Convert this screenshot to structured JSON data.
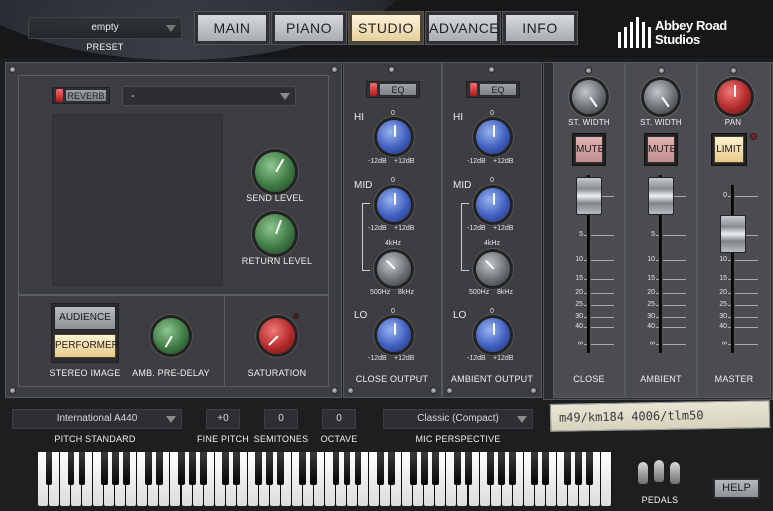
{
  "header": {
    "preset_value": "empty",
    "preset_label": "PRESET",
    "tabs": [
      "MAIN",
      "PIANO",
      "STUDIO",
      "ADVANCED",
      "INFO"
    ],
    "active_tab": "STUDIO",
    "logo_line1": "Abbey Road",
    "logo_line2": "Studios"
  },
  "reverb": {
    "toggle_label": "REVERB",
    "type_value": "-",
    "send_level_label": "SEND LEVEL",
    "return_level_label": "RETURN LEVEL"
  },
  "stereo": {
    "audience_label": "AUDIENCE",
    "performer_label": "PERFORMER",
    "stereo_image_label": "STEREO IMAGE",
    "pre_delay_label": "AMB. PRE-DELAY",
    "saturation_label": "SATURATION"
  },
  "eq": {
    "button_label": "EQ",
    "hi": "HI",
    "mid": "MID",
    "lo": "LO",
    "zero": "0",
    "minus": "-12dB",
    "plus": "+12dB",
    "freq_top": "4kHz",
    "freq_left": "500Hz",
    "freq_right": "8kHz",
    "close_output_label": "CLOSE OUTPUT",
    "ambient_output_label": "AMBIENT OUTPUT"
  },
  "mixer": {
    "st_width": "ST. WIDTH",
    "pan": "PAN",
    "mute": "MUTE",
    "limit": "LIMIT",
    "scale": [
      "0",
      "5",
      "10",
      "15",
      "20",
      "25",
      "30",
      "40",
      "∞"
    ],
    "channels": [
      "CLOSE",
      "AMBIENT",
      "MASTER"
    ],
    "mic_note": "m49/km184 4006/tlm50"
  },
  "bottom": {
    "pitch_standard_value": "International  A440",
    "pitch_standard_label": "PITCH STANDARD",
    "fine_pitch_value": "+0",
    "fine_pitch_label": "FINE PITCH",
    "semitones_value": "0",
    "semitones_label": "SEMITONES",
    "octave_value": "0",
    "octave_label": "OCTAVE",
    "mic_perspective_value": "Classic (Compact)",
    "mic_perspective_label": "MIC PERSPECTIVE",
    "pedals_label": "PEDALS",
    "help_label": "HELP"
  }
}
